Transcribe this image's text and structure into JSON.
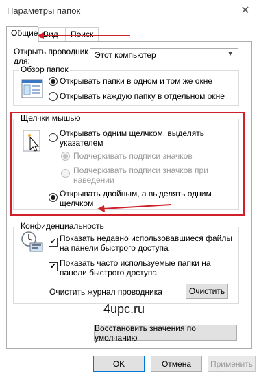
{
  "window": {
    "title": "Параметры папок",
    "close_icon": "close-icon"
  },
  "tabs": [
    {
      "label": "Общие",
      "active": true
    },
    {
      "label": "Вид",
      "active": false
    },
    {
      "label": "Поиск",
      "active": false
    }
  ],
  "general": {
    "open_explorer": {
      "label": "Открыть проводник для:",
      "value": "Этот компьютер"
    },
    "browse_folders": {
      "legend": "Обзор папок",
      "options": [
        {
          "label": "Открывать папки в одном и том же окне",
          "selected": true
        },
        {
          "label": "Открывать каждую папку в отдельном окне",
          "selected": false
        }
      ]
    },
    "mouse_clicks": {
      "legend": "Щелчки мышью",
      "single_click": {
        "label": "Открывать одним щелчком, выделять указателем",
        "selected": false
      },
      "sub_options": [
        {
          "label": "Подчеркивать подписи значков",
          "selected": true,
          "disabled": true
        },
        {
          "label": "Подчеркивать подписи значков при наведении",
          "selected": false,
          "disabled": true
        }
      ],
      "double_click": {
        "label": "Открывать двойным, а выделять одним щелчком",
        "selected": true
      }
    },
    "privacy": {
      "legend": "Конфиденциальность",
      "checkboxes": [
        {
          "label": "Показать недавно использовавшиеся файлы на панели быстрого доступа",
          "checked": true
        },
        {
          "label": "Показать часто используемые папки на панели быстрого доступа",
          "checked": true
        }
      ],
      "clear_history": {
        "label": "Очистить журнал проводника",
        "button": "Очистить"
      }
    },
    "watermark": "4upc.ru",
    "restore_defaults": "Восстановить значения по умолчанию"
  },
  "footer": {
    "ok": "OK",
    "cancel": "Отмена",
    "apply": "Применить"
  },
  "colors": {
    "highlight": "#d0202a",
    "border": "#adadad",
    "disabled_text": "#9a9a9a"
  }
}
